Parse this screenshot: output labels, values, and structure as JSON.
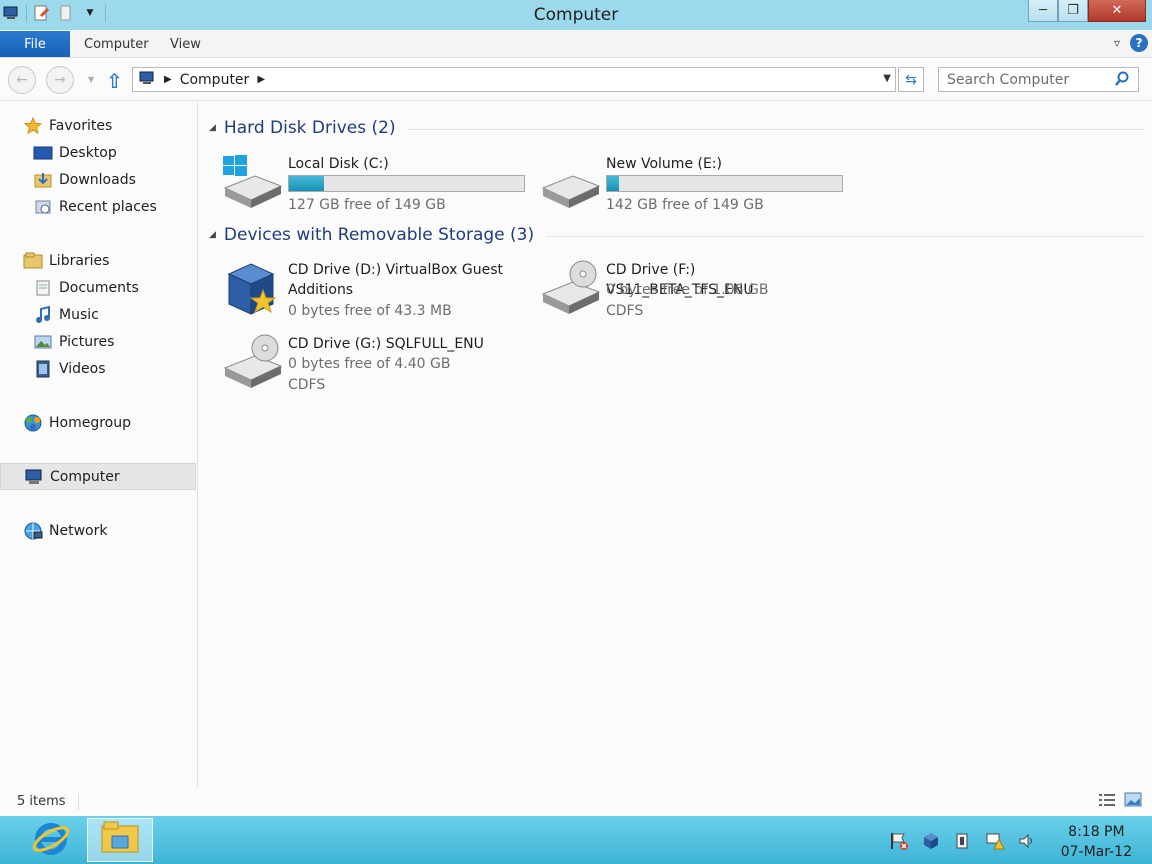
{
  "window": {
    "title": "Computer"
  },
  "ribbon": {
    "file_label": "File",
    "tabs": [
      "Computer",
      "View"
    ]
  },
  "address": {
    "crumb": "Computer"
  },
  "search": {
    "placeholder": "Search Computer"
  },
  "sidebar": {
    "favorites": {
      "label": "Favorites",
      "items": [
        "Desktop",
        "Downloads",
        "Recent places"
      ]
    },
    "libraries": {
      "label": "Libraries",
      "items": [
        "Documents",
        "Music",
        "Pictures",
        "Videos"
      ]
    },
    "homegroup": "Homegroup",
    "computer": "Computer",
    "network": "Network"
  },
  "groups": {
    "hdd": {
      "title": "Hard Disk Drives (2)"
    },
    "removable": {
      "title": "Devices with Removable Storage (3)"
    }
  },
  "drives": {
    "c": {
      "name": "Local Disk (C:)",
      "free": "127 GB free of 149 GB",
      "used_fraction": 0.15
    },
    "e": {
      "name": "New Volume (E:)",
      "free": "142 GB free of 149 GB",
      "used_fraction": 0.05
    },
    "d": {
      "name": "CD Drive (D:) VirtualBox Guest Additions",
      "free": "0 bytes free of 43.3 MB"
    },
    "f": {
      "name": "CD Drive (F:) VS11_BETA_TFS_ENU",
      "free": "0 bytes free of 1.06 GB",
      "fs": "CDFS"
    },
    "g": {
      "name": "CD Drive (G:) SQLFULL_ENU",
      "free": "0 bytes free of 4.40 GB",
      "fs": "CDFS"
    }
  },
  "status": {
    "count": "5 items"
  },
  "taskbar": {
    "time": "8:18 PM",
    "date": "07-Mar-12"
  },
  "colors": {
    "titlebar": "#9dd9ec",
    "file_tab": "#1e6fc4",
    "group_title": "#1f3d7a",
    "taskbar": "#4fc0e0",
    "bar_fill": "#26a3c7"
  }
}
